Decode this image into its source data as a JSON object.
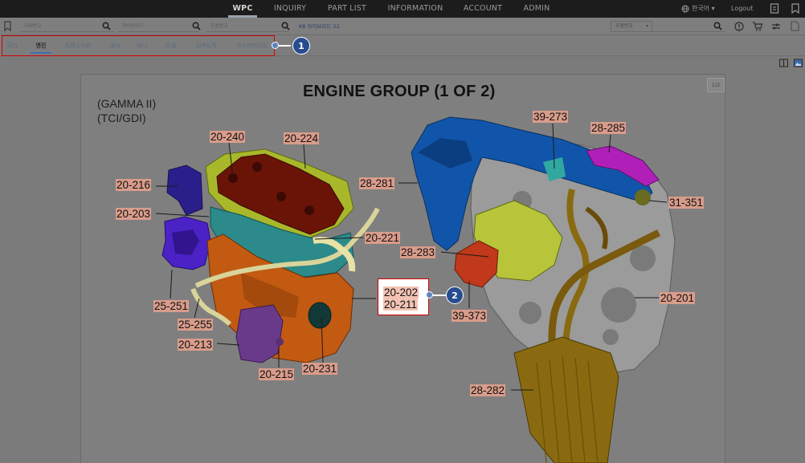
{
  "nav": {
    "items": [
      "WPC",
      "INQUIRY",
      "PART LIST",
      "INFORMATION",
      "ACCOUNT",
      "ADMIN"
    ],
    "active": "WPC",
    "language": "한국어",
    "logout": "Logout"
  },
  "search": {
    "vin_placeholder": "차대번호",
    "model_placeholder": "하이브리드",
    "part_placeholder": "부품번호",
    "vehicle": "K8 하이브리드 22",
    "part_select": "부품번호"
  },
  "tabs": [
    "모터",
    "엔진",
    "트랜스미션",
    "섀시",
    "바디",
    "트림",
    "일렉트릭",
    "커스터마이징"
  ],
  "active_tab": "엔진",
  "markers": [
    "1",
    "2"
  ],
  "document": {
    "page": "1/2",
    "title": "ENGINE GROUP (1 OF 2)",
    "subtitle1": "(GAMMA II)",
    "subtitle2": "(TCI/GDI)",
    "labels": {
      "l20240": "20-240",
      "l20224": "20-224",
      "l20216": "20-216",
      "l20203": "20-203",
      "l20221": "20-221",
      "l25251": "25-251",
      "l25255": "25-255",
      "l20213": "20-213",
      "l20215": "20-215",
      "l20231": "20-231",
      "l39273": "39-273",
      "l28285": "28-285",
      "l28281": "28-281",
      "l31351": "31-351",
      "l28283": "28-283",
      "l39373": "39-373",
      "l20201": "20-201",
      "l28282": "28-282"
    },
    "callout": [
      "20-202",
      "20-211"
    ]
  },
  "colors": {
    "nav_bg": "#1c1c1c",
    "highlight_box": "#d40000",
    "marker": "#274c8f",
    "label_bg": "#d99c8b",
    "engine_orange": "#c25a12",
    "intake_blue": "#1155aa"
  },
  "icons": [
    "globe-icon",
    "search-icon",
    "bookmark-icon",
    "info-icon",
    "cart-icon",
    "settings-icon",
    "document-icon",
    "split-view-icon",
    "image-view-icon"
  ]
}
